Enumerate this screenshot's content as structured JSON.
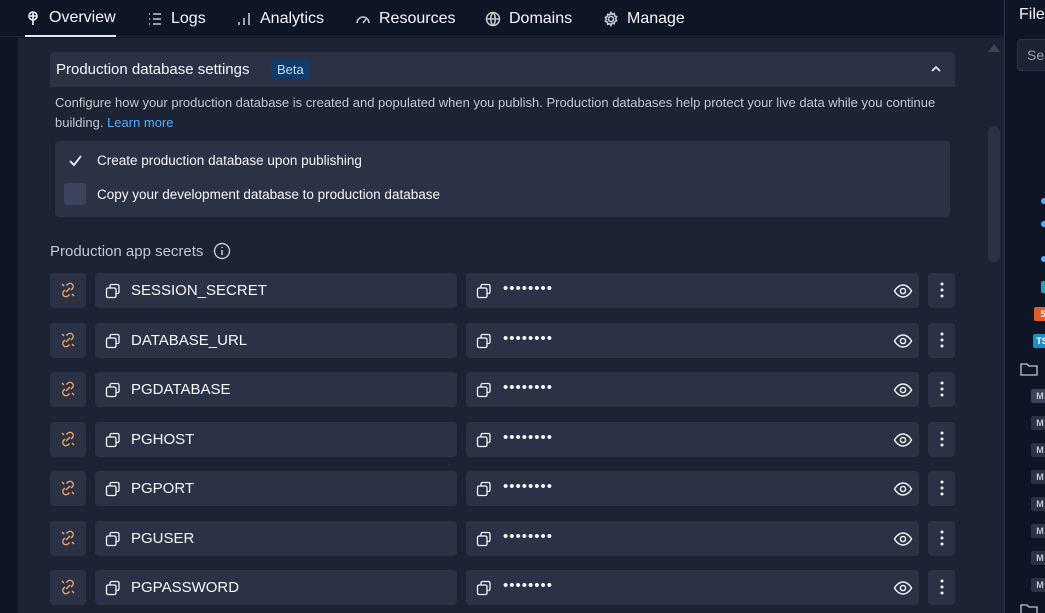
{
  "tabs": [
    {
      "label": "Overview",
      "icon": "pin-icon",
      "active": true
    },
    {
      "label": "Logs",
      "icon": "list-icon"
    },
    {
      "label": "Analytics",
      "icon": "bar-chart-icon"
    },
    {
      "label": "Resources",
      "icon": "gauge-icon"
    },
    {
      "label": "Domains",
      "icon": "globe-icon"
    },
    {
      "label": "Manage",
      "icon": "gear-icon"
    }
  ],
  "settings": {
    "title": "Production database settings",
    "badge": "Beta",
    "description": "Configure how your production database is created and populated when you publish. Production databases help protect your live data while you continue building.",
    "learn_more": "Learn more",
    "options": [
      {
        "label": "Create production database upon publishing",
        "checked": true
      },
      {
        "label": "Copy your development database to production database",
        "checked": false
      }
    ]
  },
  "secrets": {
    "title": "Production app secrets",
    "masked_value": "••••••••",
    "items": [
      {
        "key": "SESSION_SECRET"
      },
      {
        "key": "DATABASE_URL"
      },
      {
        "key": "PGDATABASE"
      },
      {
        "key": "PGHOST"
      },
      {
        "key": "PGPORT"
      },
      {
        "key": "PGUSER"
      },
      {
        "key": "PGPASSWORD"
      }
    ]
  },
  "files_panel": {
    "title": "Files",
    "search_placeholder": "Search"
  },
  "colors": {
    "accent_link": "#57abff",
    "link_icon": "#f0a46b",
    "badge_bg": "#0f3c69"
  }
}
